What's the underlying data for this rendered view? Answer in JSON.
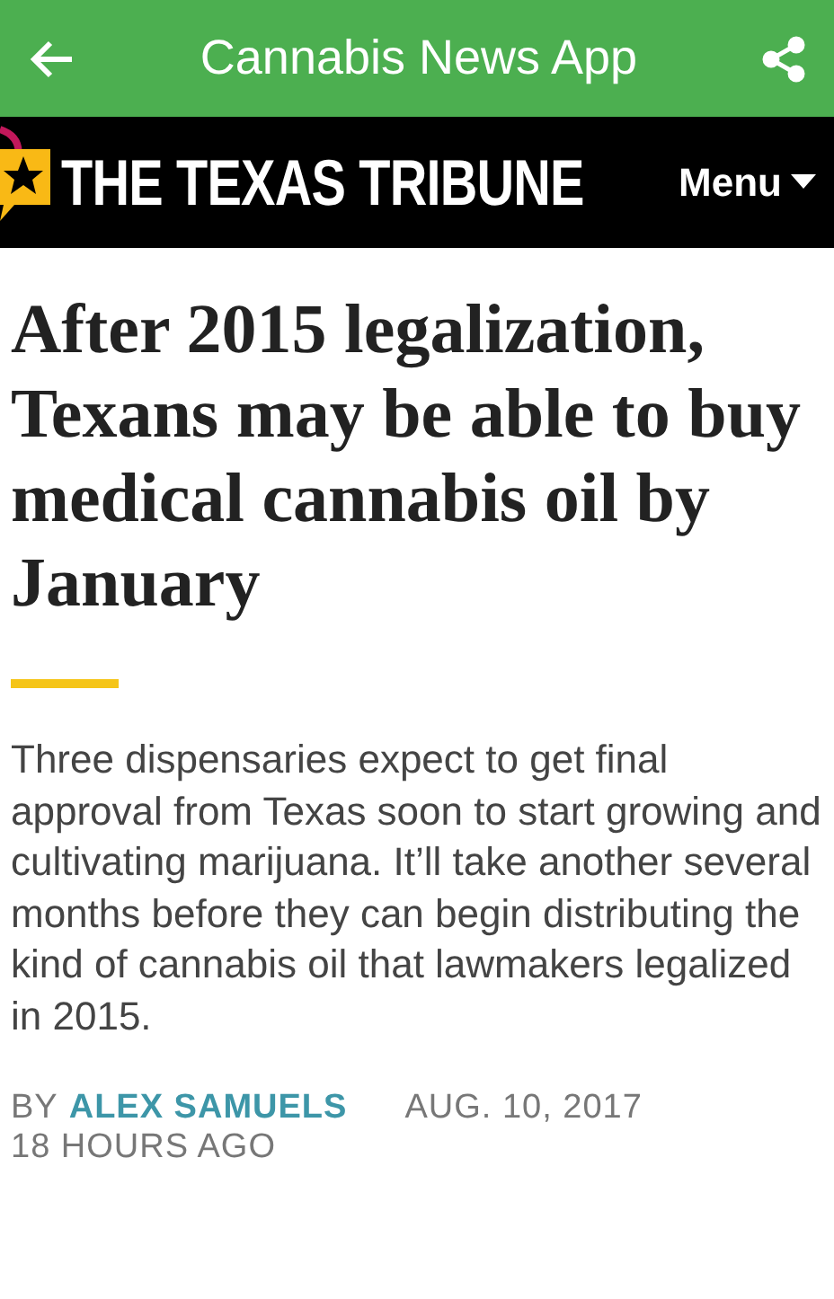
{
  "app_bar": {
    "title": "Cannabis News App"
  },
  "site_header": {
    "logo": "THE TEXAS TRIBUNE",
    "menu": "Menu"
  },
  "article": {
    "headline": "After 2015 legalization, Texans may be able to buy medical cannabis oil by January",
    "summary": "Three dispensaries expect to get final approval from Texas soon to start growing and cultivating marijuana. It’ll take another several months before they can begin distributing the kind of cannabis oil that lawmakers legalized in 2015.",
    "byline_prefix": "BY",
    "author": "ALEX SAMUELS",
    "date": "AUG. 10, 2017",
    "age": "18 HOURS AGO"
  }
}
